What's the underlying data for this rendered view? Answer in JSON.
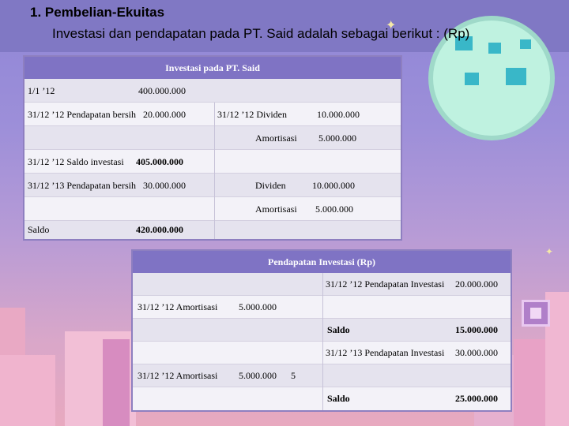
{
  "slide": {
    "title": "1. Pembelian-Ekuitas",
    "subtitle": "Investasi dan pendapatan pada PT. Said adalah sebagai berikut : (Rp)"
  },
  "investment_account": {
    "title": "Investasi pada PT. Said",
    "rows": [
      {
        "left_label": "1/1 ’12",
        "left_value": "400.000.000",
        "right_label": "",
        "right_value": ""
      },
      {
        "left_label": "31/12 ’12 Pendapatan bersih",
        "left_value": "20.000.000",
        "right_label": "31/12 ’12  Dividen",
        "right_value": "10.000.000"
      },
      {
        "left_label": "",
        "left_value": "",
        "right_label": "Amortisasi",
        "right_value": "5.000.000"
      },
      {
        "left_label": "31/12 ’12 Saldo investasi",
        "left_value": "405.000.000",
        "right_label": "",
        "right_value": ""
      },
      {
        "left_label": "31/12 ’13 Pendapatan bersih",
        "left_value": "30.000.000",
        "right_label": "Dividen",
        "right_value": "10.000.000"
      },
      {
        "left_label": "",
        "left_value": "",
        "right_label": "Amortisasi",
        "right_value": "5.000.000"
      },
      {
        "left_label": "Saldo",
        "left_value": "420.000.000",
        "right_label": "",
        "right_value": ""
      }
    ]
  },
  "income_account": {
    "title": "Pendapatan Investasi (Rp)",
    "rows": [
      {
        "left_label": "",
        "left_value": "",
        "right_label": "31/12 ’12  Pendapatan Investasi",
        "right_value": "20.000.000"
      },
      {
        "left_label": "31/12 ’12 Amortisasi",
        "left_value": "5.000.000",
        "right_label": "",
        "right_value": ""
      },
      {
        "left_label": "",
        "left_value": "",
        "right_label": "Saldo",
        "right_value": "15.000.000"
      },
      {
        "left_label": "",
        "left_value": "",
        "right_label": "31/12 ’13  Pendapatan Investasi",
        "right_value": "30.000.000"
      },
      {
        "left_label": "31/12 ’12  Amortisasi",
        "left_value": "5.000.000",
        "extra": "5",
        "right_label": "",
        "right_value": ""
      },
      {
        "left_label": "",
        "left_value": "",
        "right_label": "Saldo",
        "right_value": "25.000.000"
      }
    ]
  }
}
